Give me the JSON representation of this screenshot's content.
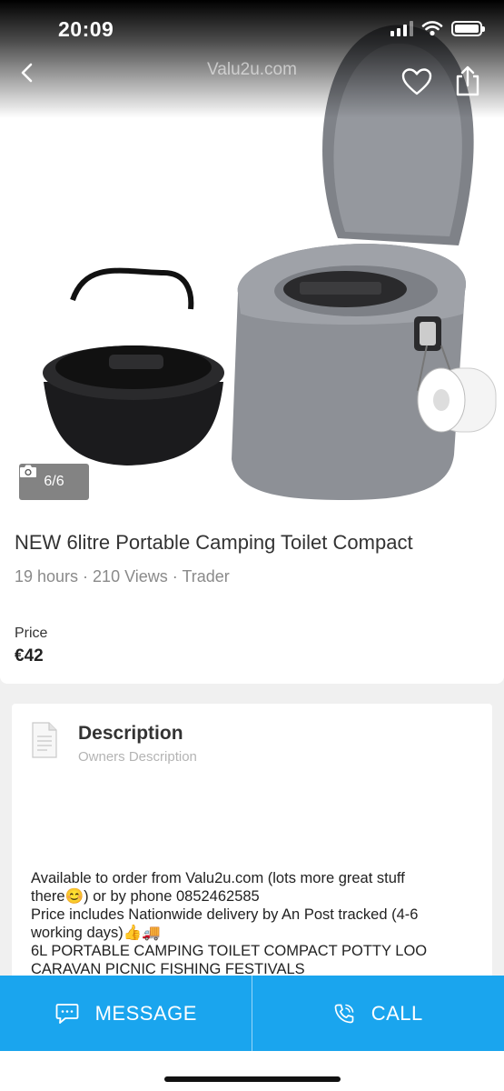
{
  "status_bar": {
    "time": "20:09"
  },
  "header": {
    "site_title": "Valu2u.com",
    "icons": [
      "back-icon",
      "heart-icon",
      "share-icon"
    ]
  },
  "gallery": {
    "photo_counter": "6/6",
    "camera_icon": "camera-icon"
  },
  "listing": {
    "title": "NEW 6litre Portable Camping Toilet Compact",
    "meta": "19 hours · 210 Views · Trader",
    "price_label": "Price",
    "price": "€42"
  },
  "description": {
    "heading": "Description",
    "subheading": "Owners Description",
    "lines": [
      "Available to order from Valu2u.com (lots more great stuff",
      "there😊) or by phone 0852462585",
      "Price includes Nationwide delivery by An Post tracked (4-6",
      "working days)👍🚚",
      "6L PORTABLE CAMPING TOILET COMPACT POTTY LOO",
      "CARAVAN PICNIC FISHING FESTIVALS"
    ]
  },
  "actions": {
    "message_label": "MESSAGE",
    "call_label": "CALL"
  },
  "colors": {
    "accent": "#1aa5ee",
    "background": "#f0f0f0",
    "meta_text": "#8a8a8a"
  }
}
